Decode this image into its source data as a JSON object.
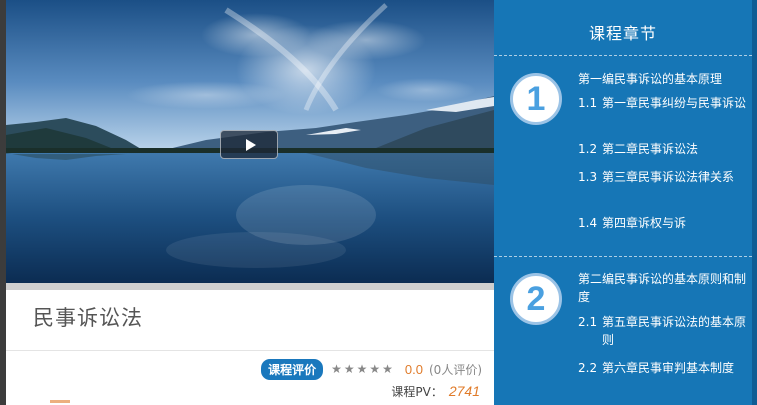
{
  "player": {
    "play_icon": "play-icon"
  },
  "course": {
    "title": "民事诉讼法",
    "rating_badge": "课程评价",
    "stars": 5,
    "star_rating": 0,
    "score": "0.0",
    "rating_count": "(0人评价)",
    "pv_label": "课程PV：",
    "pv_value": "2741"
  },
  "sidebar": {
    "title": "课程章节",
    "parts": [
      {
        "number": "1",
        "title": "第一编民事诉讼的基本原理",
        "chapters": [
          {
            "num": "1.1",
            "text": "第一章民事纠纷与民事诉讼"
          },
          {
            "num": "1.2",
            "text": "第二章民事诉讼法"
          },
          {
            "num": "1.3",
            "text": "第三章民事诉讼法律关系"
          },
          {
            "num": "1.4",
            "text": "第四章诉权与诉"
          }
        ]
      },
      {
        "number": "2",
        "title": "第二编民事诉讼的基本原则和制度",
        "chapters": [
          {
            "num": "2.1",
            "text": "第五章民事诉讼法的基本原则"
          },
          {
            "num": "2.2",
            "text": "第六章民事审判基本制度"
          }
        ]
      }
    ]
  },
  "colors": {
    "sidebar_bg": "#1676b6",
    "accent_orange": "#e07b2a",
    "badge_blue": "#1a78bd"
  }
}
